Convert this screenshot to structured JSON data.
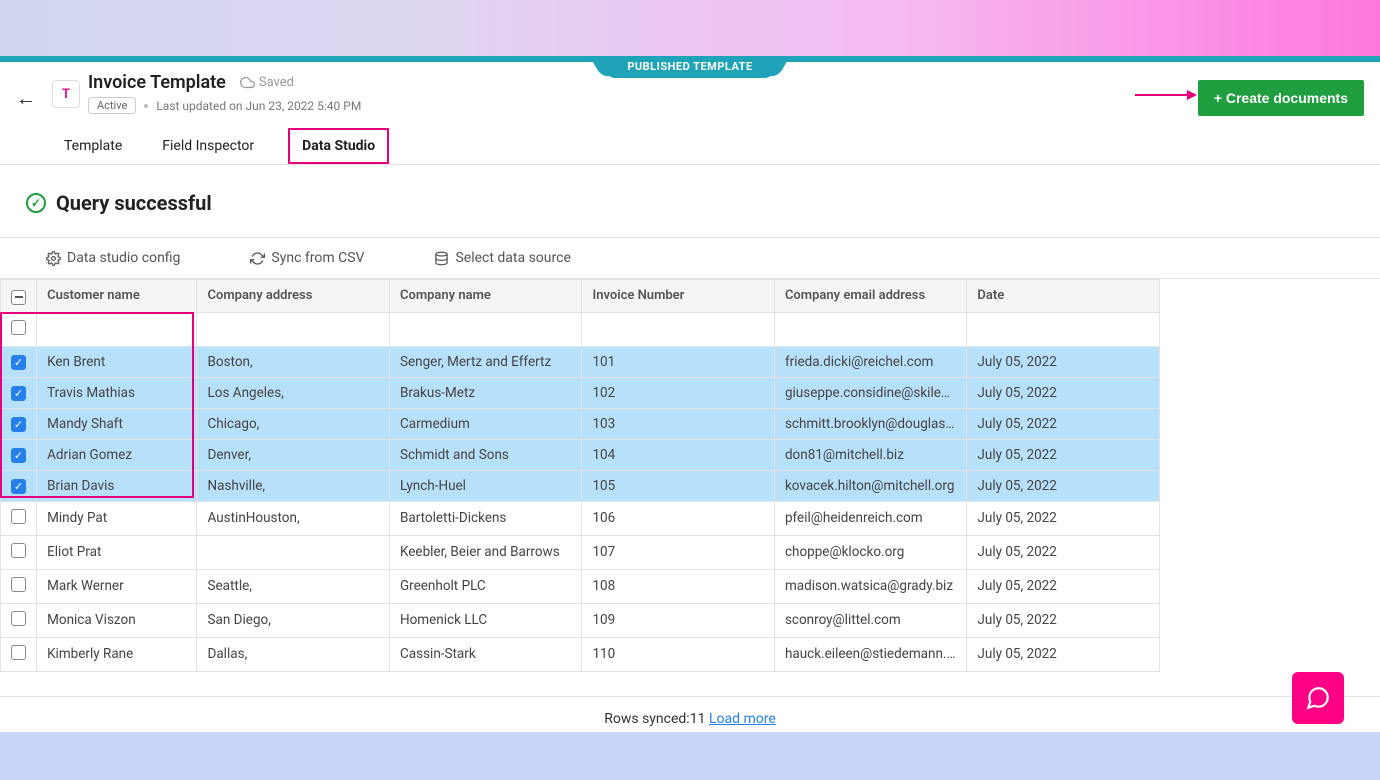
{
  "banner": {
    "published": "PUBLISHED TEMPLATE"
  },
  "header": {
    "iconLetter": "T",
    "title": "Invoice Template",
    "savedLabel": "Saved",
    "statusPill": "Active",
    "lastUpdated": "Last updated on Jun 23, 2022 5:40 PM",
    "createButton": "+ Create documents"
  },
  "tabs": {
    "template": "Template",
    "fieldInspector": "Field Inspector",
    "dataStudio": "Data Studio"
  },
  "query": {
    "status": "Query successful"
  },
  "toolbar": {
    "config": "Data studio config",
    "sync": "Sync from CSV",
    "source": "Select data source"
  },
  "columns": {
    "name": "Customer name",
    "addr": "Company address",
    "comp": "Company name",
    "inv": "Invoice Number",
    "email": "Company email address",
    "date": "Date"
  },
  "rows": [
    {
      "selected": true,
      "name": "Ken Brent",
      "addr": "Boston,",
      "comp": "Senger, Mertz and Effertz",
      "inv": "101",
      "email": "frieda.dicki@reichel.com",
      "date": "July 05, 2022"
    },
    {
      "selected": true,
      "name": "Travis Mathias",
      "addr": "Los Angeles,",
      "comp": "Brakus-Metz",
      "inv": "102",
      "email": "giuseppe.considine@skiles.biz",
      "date": "July 05, 2022"
    },
    {
      "selected": true,
      "name": "Mandy Shaft",
      "addr": "Chicago,",
      "comp": "Carmedium",
      "inv": "103",
      "email": "schmitt.brooklyn@douglas.biz",
      "date": "July 05, 2022"
    },
    {
      "selected": true,
      "name": "Adrian Gomez",
      "addr": "Denver,",
      "comp": "Schmidt and Sons",
      "inv": "104",
      "email": "don81@mitchell.biz",
      "date": "July 05, 2022"
    },
    {
      "selected": true,
      "name": "Brian Davis",
      "addr": "Nashville,",
      "comp": "Lynch-Huel",
      "inv": "105",
      "email": "kovacek.hilton@mitchell.org",
      "date": "July 05, 2022"
    },
    {
      "selected": false,
      "name": "Mindy Pat",
      "addr": "AustinHouston,",
      "comp": "Bartoletti-Dickens",
      "inv": "106",
      "email": "pfeil@heidenreich.com",
      "date": "July 05, 2022"
    },
    {
      "selected": false,
      "name": "Eliot Prat",
      "addr": "",
      "comp": "Keebler, Beier and Barrows",
      "inv": "107",
      "email": "choppe@klocko.org",
      "date": "July 05, 2022"
    },
    {
      "selected": false,
      "name": "Mark Werner",
      "addr": "Seattle,",
      "comp": "Greenholt PLC",
      "inv": "108",
      "email": "madison.watsica@grady.biz",
      "date": "July 05, 2022"
    },
    {
      "selected": false,
      "name": "Monica Viszon",
      "addr": "San Diego,",
      "comp": "Homenick LLC",
      "inv": "109",
      "email": "sconroy@littel.com",
      "date": "July 05, 2022"
    },
    {
      "selected": false,
      "name": "Kimberly Rane",
      "addr": "Dallas,",
      "comp": "Cassin-Stark",
      "inv": "110",
      "email": "hauck.eileen@stiedemann.com",
      "date": "July 05, 2022"
    }
  ],
  "footer": {
    "syncedLabel": "Rows synced:",
    "syncedCount": "11",
    "loadMore": "Load more"
  }
}
